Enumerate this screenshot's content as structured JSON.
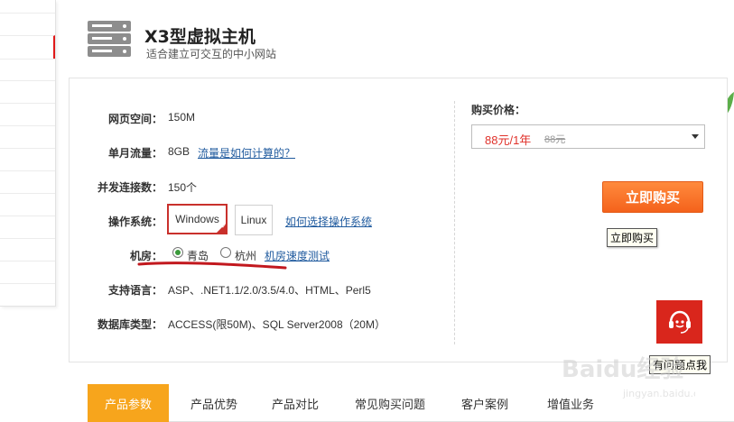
{
  "header": {
    "title": "X3型虚拟主机",
    "subtitle": "适合建立可交互的中小网站",
    "icon": "server-icon"
  },
  "specs": {
    "space_label": "网页空间：",
    "space_value": "150M",
    "traffic_label": "单月流量：",
    "traffic_value": "8GB",
    "traffic_link": "流量是如何计算的？",
    "conn_label": "并发连接数：",
    "conn_value": "150个",
    "os_label": "操作系统：",
    "os_options": [
      "Windows",
      "Linux"
    ],
    "os_selected": "Windows",
    "os_link": "如何选择操作系统",
    "room_label": "机房：",
    "room_options": [
      "青岛",
      "杭州"
    ],
    "room_selected": "青岛",
    "room_link": "机房速度测试",
    "lang_label": "支持语言：",
    "lang_value": "ASP、.NET1.1/2.0/3.5/4.0、HTML、Perl5",
    "db_label": "数据库类型：",
    "db_value": "ACCESS(限50M)、SQL Server2008（20M）"
  },
  "purchase": {
    "price_label": "购买价格：",
    "price_selected": "88元/1年",
    "price_original": "88元",
    "buy_button": "立即购买",
    "buy_tooltip": "立即购买",
    "support_tooltip": "有问题点我",
    "support_icon": "customer-service-icon"
  },
  "tabs": [
    {
      "label": "产品参数",
      "active": true
    },
    {
      "label": "产品优势",
      "active": false
    },
    {
      "label": "产品对比",
      "active": false
    },
    {
      "label": "常见购买问题",
      "active": false
    },
    {
      "label": "客户案例",
      "active": false
    },
    {
      "label": "增值业务",
      "active": false
    }
  ],
  "colors": {
    "accent_red": "#c9302c",
    "price_red": "#e0322b",
    "buy_orange": "#f4621c",
    "tab_active": "#f7a51c",
    "link_blue": "#1f5a9e",
    "support_red": "#d9261c"
  },
  "watermark": {
    "text": "Baidu经验",
    "url": "jingyan.baidu.com"
  }
}
